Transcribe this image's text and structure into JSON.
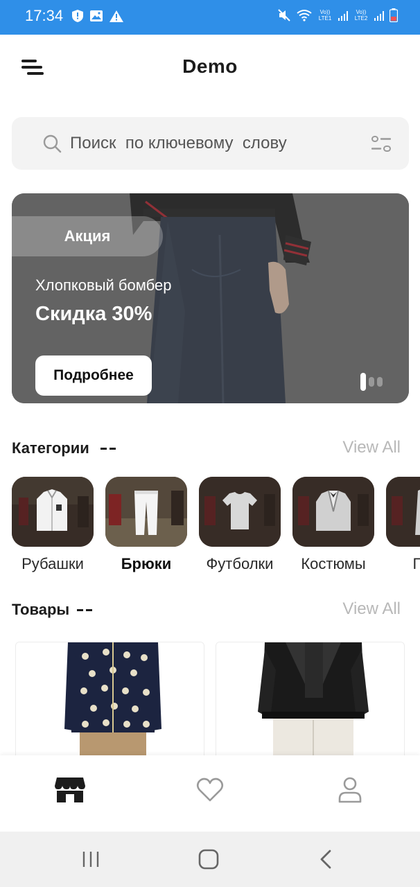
{
  "status_bar": {
    "time": "17:34",
    "left_icons": [
      "shield-icon",
      "image-icon",
      "warning-icon"
    ],
    "right_icons": [
      "mute-icon",
      "wifi-icon",
      "signal-icon",
      "signal-icon",
      "battery-icon"
    ],
    "sim1_label": "Vo)) LTE1",
    "sim2_label": "Vo)) LTE2"
  },
  "header": {
    "title": "Demo",
    "menu_icon": "menu-icon"
  },
  "search": {
    "placeholder": "Поиск  по ключевому  слову",
    "value": "",
    "search_icon": "search-icon",
    "filter_icon": "filter-icon"
  },
  "banner": {
    "tag": "Акция",
    "subtitle": "Хлопковый бомбер",
    "title": "Скидка 30%",
    "button_label": "Подробнее",
    "slide_count": 3,
    "active_slide": 1
  },
  "categories": {
    "title": "Категории",
    "view_all": "View All",
    "items": [
      {
        "label": "Рубашки",
        "icon": "shirt-icon",
        "selected": false
      },
      {
        "label": "Брюки",
        "icon": "trousers-icon",
        "selected": true
      },
      {
        "label": "Футболки",
        "icon": "tshirt-icon",
        "selected": false
      },
      {
        "label": "Костюмы",
        "icon": "suit-icon",
        "selected": false
      },
      {
        "label": "Пал",
        "icon": "coat-icon",
        "selected": false
      }
    ]
  },
  "products": {
    "title": "Товары",
    "view_all": "View All"
  },
  "bottom_nav": {
    "items": [
      {
        "icon": "store-icon",
        "active": true
      },
      {
        "icon": "heart-icon",
        "active": false
      },
      {
        "icon": "profile-icon",
        "active": false
      }
    ]
  },
  "system_nav": {
    "items": [
      "recent-apps-icon",
      "home-icon",
      "back-icon"
    ]
  },
  "colors": {
    "status_bar": "#2f8fe8",
    "text_dark": "#1c1c1c",
    "view_all": "#b8b8b8",
    "search_bg": "#f3f3f3",
    "banner_overlay": "#6c6c6c"
  }
}
